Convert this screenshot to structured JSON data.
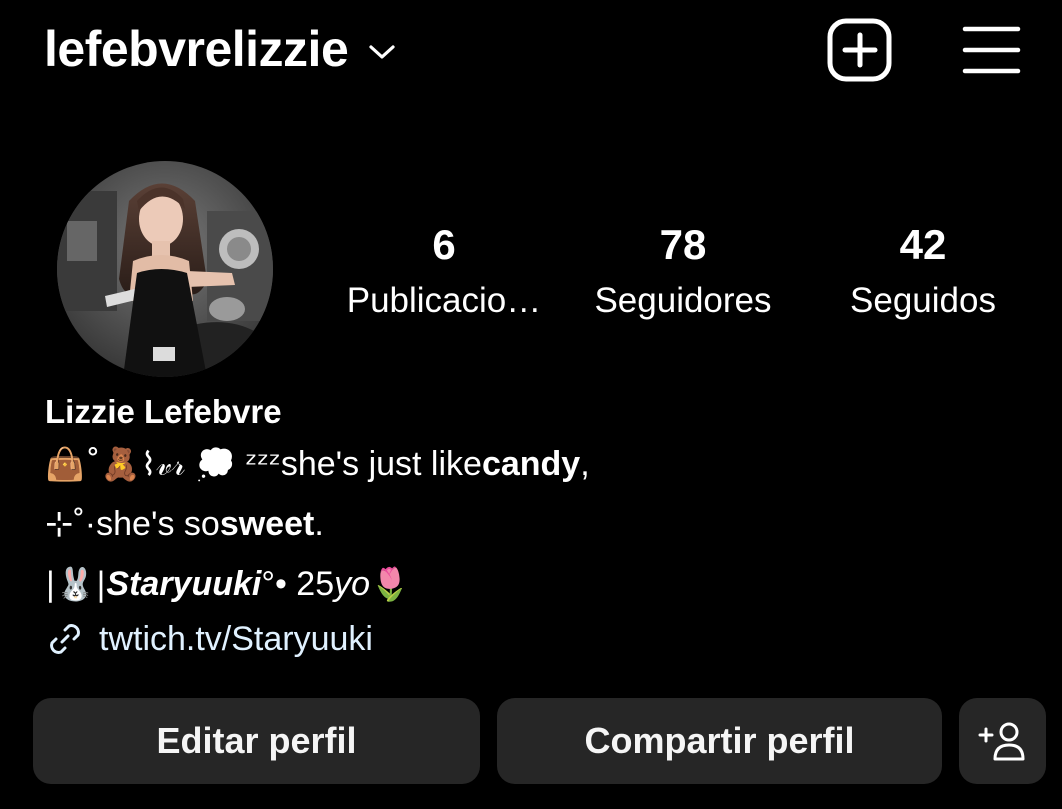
{
  "header": {
    "username": "lefebvrelizzie",
    "icons": {
      "account_switcher": "chevron-down-icon",
      "new_post": "plus-square-icon",
      "menu": "hamburger-menu-icon"
    }
  },
  "profile": {
    "avatar_icon": "avatar-photo",
    "stats": [
      {
        "value": "6",
        "label": "Publicacio…"
      },
      {
        "value": "78",
        "label": "Seguidores"
      },
      {
        "value": "42",
        "label": "Seguidos"
      }
    ],
    "full_name": "Lizzie Lefebvre",
    "bio": {
      "line1": {
        "prefix": "👜˚🧸⌇𝓋𝓇 💭 ᶻᶻᶻ ",
        "text_before": "she's just like ",
        "bold": "candy",
        "after": ","
      },
      "line2": {
        "prefix": "⊹˚· ",
        "text_before": "she's so ",
        "bold": "sweet",
        "after": "."
      },
      "line3": {
        "prefix": "|🐰| ",
        "bold_italic": "Staryuuki",
        "mid": " °• 25 ",
        "italic": "yo",
        "emoji": "🌷"
      }
    },
    "link": {
      "icon": "link-icon",
      "text": "twtich.tv/Staryuuki"
    }
  },
  "actions": {
    "edit_label": "Editar perfil",
    "share_label": "Compartir perfil",
    "add_person_icon": "add-person-icon"
  },
  "colors": {
    "background": "#000000",
    "button_bg": "#262626",
    "link": "#e0f1ff"
  }
}
